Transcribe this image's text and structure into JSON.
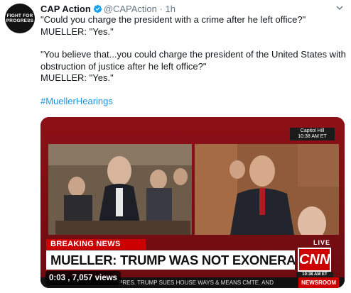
{
  "account": {
    "avatar_line1": "FIGHT FOR",
    "avatar_line2": "PROGRESS",
    "name": "CAP Action",
    "handle": "@CAPAction",
    "separator": "·",
    "time": "1h",
    "verified_icon": "verified-badge-icon"
  },
  "tweet": {
    "line1": "\"Could you charge the president with a crime after he left office?\"",
    "line2": "MUELLER: \"Yes.\"",
    "line3": "\"You believe that...you could charge the president of the United States with",
    "line4": "obstruction of justice after he left office?\"",
    "line5": "MUELLER: \"Yes.\"",
    "hashtag": "#MuellerHearings"
  },
  "media": {
    "capitol_line1": "Capitol Hill",
    "capitol_line2": "10:38 AM ET",
    "breaking": "BREAKING NEWS",
    "live": "LIVE",
    "headline": "MUELLER: TRUMP WAS NOT EXONERATED",
    "cnn_logo": "CNN",
    "cnn_time": "10:38 AM ET",
    "ticker": "PRES. TRUMP SUES HOUSE WAYS & MEANS CMTE. AND",
    "newsroom": "NEWSROOM",
    "video_time": "0:03",
    "video_views": "7,057 views"
  },
  "colors": {
    "verified": "#1da1f2",
    "link": "#1b95e0",
    "cnn_red": "#cc0000"
  }
}
